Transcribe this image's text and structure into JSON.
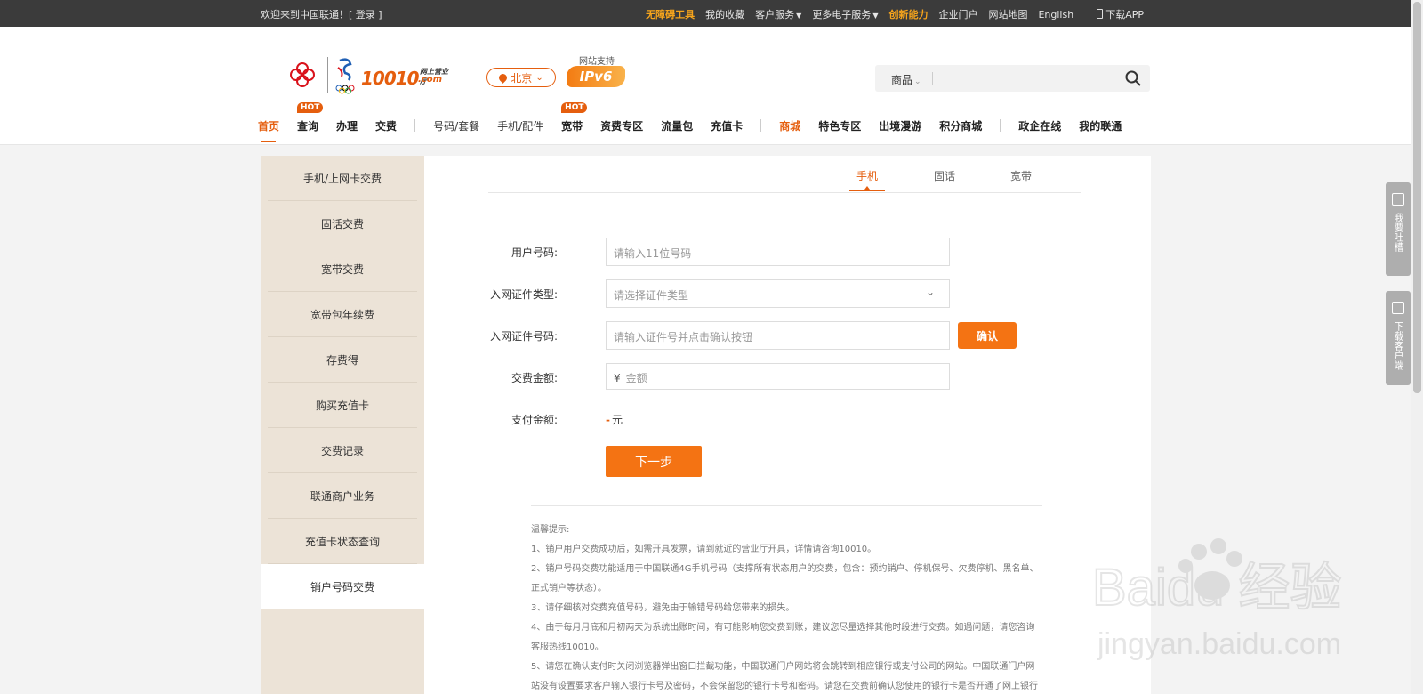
{
  "topbar": {
    "welcome": "欢迎来到中国联通！[ 登录 ]",
    "links": [
      {
        "label": "无障碍工具",
        "highlight": true
      },
      {
        "label": "我的收藏"
      },
      {
        "label": "客户服务",
        "dropdown": true
      },
      {
        "label": "更多电子服务",
        "dropdown": true
      },
      {
        "label": "创新能力",
        "highlight": true
      },
      {
        "label": "企业门户"
      },
      {
        "label": "网站地图"
      },
      {
        "label": "English"
      }
    ],
    "download_app": "下载APP"
  },
  "logo": {
    "number": "10010",
    "sub_top": "网上营业厅",
    "sub_bottom": ".com"
  },
  "city": "北京",
  "ipv6": {
    "label": "网站支持",
    "badge": "IPv6"
  },
  "search": {
    "category": "商品",
    "placeholder": ""
  },
  "nav": [
    {
      "label": "首页",
      "active": true
    },
    {
      "label": "查询",
      "hot": "HOT"
    },
    {
      "label": "办理"
    },
    {
      "label": "交费"
    },
    {
      "sep": true
    },
    {
      "label": "号码/套餐",
      "light": true
    },
    {
      "label": "手机/配件",
      "light": true
    },
    {
      "label": "宽带",
      "hot": "HOT"
    },
    {
      "label": "资费专区"
    },
    {
      "label": "流量包"
    },
    {
      "label": "充值卡"
    },
    {
      "sep": true
    },
    {
      "label": "商城",
      "orange": true
    },
    {
      "label": "特色专区"
    },
    {
      "label": "出境漫游"
    },
    {
      "label": "积分商城"
    },
    {
      "sep": true
    },
    {
      "label": "政企在线"
    },
    {
      "label": "我的联通"
    }
  ],
  "side_menu": [
    "手机/上网卡交费",
    "固话交费",
    "宽带交费",
    "宽带包年续费",
    "存费得",
    "购买充值卡",
    "交费记录",
    "联通商户业务",
    "充值卡状态查询",
    "销户号码交费"
  ],
  "side_active_index": 9,
  "tabs": [
    "手机",
    "固话",
    "宽带"
  ],
  "form": {
    "user_number_label": "用户号码:",
    "user_number_placeholder": "请输入11位号码",
    "id_type_label": "入网证件类型:",
    "id_type_placeholder": "请选择证件类型",
    "id_number_label": "入网证件号码:",
    "id_number_placeholder": "请输入证件号并点击确认按钮",
    "confirm_button": "确认",
    "amount_label": "交费金额:",
    "amount_symbol": "¥",
    "amount_placeholder": "金额",
    "pay_label": "支付金额:",
    "pay_value": "-",
    "pay_unit": "元",
    "next_button": "下一步"
  },
  "tips": {
    "title": "温馨提示:",
    "items": [
      "1、销户用户交费成功后，如需开具发票，请到就近的营业厅开具，详情请咨询10010。",
      "2、销户号码交费功能适用于中国联通4G手机号码（支撑所有状态用户的交费，包含：预约销户、停机保号、欠费停机、黑名单、正式销户等状态）。",
      "3、请仔细核对交费充值号码，避免由于输错号码给您带来的损失。",
      "4、由于每月月底和月初两天为系统出账时间，有可能影响您交费到账，建议您尽量选择其他时段进行交费。如遇问题，请您咨询客服热线10010。",
      "5、请您在确认支付时关闭浏览器弹出窗口拦截功能，中国联通门户网站将会跳转到相应银行或支付公司的网站。中国联通门户网站没有设置要求客户输入银行卡号及密码，不会保留您的银行卡号和密码。请您在交费前确认您使用的银行卡是否开通了网上银行"
    ]
  },
  "float": {
    "feedback": "我要吐槽",
    "download": "下载客户端"
  },
  "watermark": {
    "text": "Baidu 经验",
    "url": "jingyan.baidu.com"
  },
  "colors": {
    "accent": "#e55e0e",
    "button": "#f47313",
    "topbar": "#3b3b3b",
    "side_bg": "#ece3d7"
  }
}
